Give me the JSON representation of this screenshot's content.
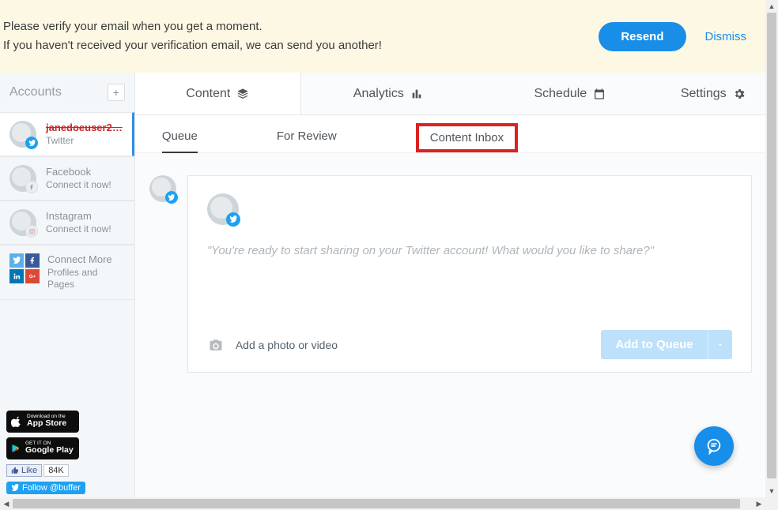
{
  "banner": {
    "line1": "Please verify your email when you get a moment.",
    "line2": "If you haven't received your verification email, we can send you another!",
    "resend": "Resend",
    "dismiss": "Dismiss"
  },
  "sidebar": {
    "title": "Accounts",
    "plus": "+",
    "accounts": [
      {
        "name": "janedoeuser2…",
        "sub": "Twitter",
        "network": "twitter",
        "active": true,
        "strike": true
      },
      {
        "name": "Facebook",
        "sub": "Connect it now!",
        "network": "facebook",
        "active": false,
        "strike": false
      },
      {
        "name": "Instagram",
        "sub": "Connect it now!",
        "network": "instagram",
        "active": false,
        "strike": false
      }
    ],
    "connect_more": {
      "title": "Connect More",
      "sub": "Profiles and Pages"
    },
    "store_apple_small": "Download on the",
    "store_apple_big": "App Store",
    "store_google_small": "GET IT ON",
    "store_google_big": "Google Play",
    "fb_like_label": "Like",
    "fb_like_count": "84K",
    "tw_follow": "Follow @buffer"
  },
  "tabs": {
    "content": "Content",
    "analytics": "Analytics",
    "schedule": "Schedule",
    "settings": "Settings"
  },
  "subtabs": {
    "queue": "Queue",
    "for_review": "For Review",
    "content_inbox": "Content Inbox"
  },
  "composer": {
    "placeholder": "\"You're ready to start sharing on your Twitter account! What would you like to share?\"",
    "add_photo": "Add a photo or video",
    "add_to_queue": "Add to Queue"
  }
}
